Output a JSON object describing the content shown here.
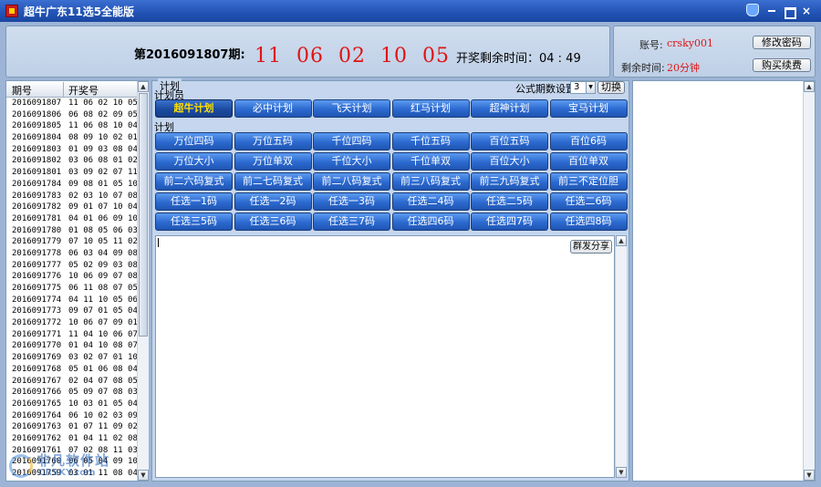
{
  "window": {
    "title": "超牛广东11选5全能版",
    "controls": {
      "minimize_icon": "minimize-icon",
      "restore_icon": "restore-icon",
      "close_label": "×"
    }
  },
  "draw": {
    "issue_label": "第2016091807期:",
    "numbers": [
      "11",
      "06",
      "02",
      "10",
      "05"
    ],
    "countdown": "开奖剩余时间：04 : 49"
  },
  "account": {
    "user_label": "账号:",
    "user_value": "crsky001",
    "remain_label": "剩余时间:",
    "remain_value": "20分钟",
    "change_pwd": "修改密码",
    "renew": "购买续费"
  },
  "history": {
    "col_issue": "期号",
    "col_numbers": "开奖号",
    "rows": [
      [
        "2016091807",
        "11 06 02 10 05"
      ],
      [
        "2016091806",
        "06 08 02 09 05"
      ],
      [
        "2016091805",
        "11 06 08 10 04"
      ],
      [
        "2016091804",
        "08 09 10 02 01"
      ],
      [
        "2016091803",
        "01 09 03 08 04"
      ],
      [
        "2016091802",
        "03 06 08 01 02"
      ],
      [
        "2016091801",
        "03 09 02 07 11"
      ],
      [
        "2016091784",
        "09 08 01 05 10"
      ],
      [
        "2016091783",
        "02 03 10 07 08"
      ],
      [
        "2016091782",
        "09 01 07 10 04"
      ],
      [
        "2016091781",
        "04 01 06 09 10"
      ],
      [
        "2016091780",
        "01 08 05 06 03"
      ],
      [
        "2016091779",
        "07 10 05 11 02"
      ],
      [
        "2016091778",
        "06 03 04 09 08"
      ],
      [
        "2016091777",
        "05 02 09 03 08"
      ],
      [
        "2016091776",
        "10 06 09 07 08"
      ],
      [
        "2016091775",
        "06 11 08 07 05"
      ],
      [
        "2016091774",
        "04 11 10 05 06"
      ],
      [
        "2016091773",
        "09 07 01 05 04"
      ],
      [
        "2016091772",
        "10 06 07 09 01"
      ],
      [
        "2016091771",
        "11 04 10 06 07"
      ],
      [
        "2016091770",
        "01 04 10 08 07"
      ],
      [
        "2016091769",
        "03 02 07 01 10"
      ],
      [
        "2016091768",
        "05 01 06 08 04"
      ],
      [
        "2016091767",
        "02 04 07 08 05"
      ],
      [
        "2016091766",
        "05 09 07 08 03"
      ],
      [
        "2016091765",
        "10 03 01 05 04"
      ],
      [
        "2016091764",
        "06 10 02 03 09"
      ],
      [
        "2016091763",
        "01 07 11 09 02"
      ],
      [
        "2016091762",
        "01 04 11 02 08"
      ],
      [
        "2016091761",
        "07 02 08 11 03"
      ],
      [
        "2016091760",
        "06 05 04 09 10"
      ],
      [
        "2016091759",
        "03 01 11 08 04"
      ]
    ]
  },
  "plan": {
    "legend": "计划",
    "planner_label": "计划员",
    "plan_label": "计划",
    "setting_label": "公式期数设置:",
    "setting_value": "3",
    "switch_label": "切换",
    "planners": [
      "超牛计划",
      "必中计划",
      "飞天计划",
      "红马计划",
      "超神计划",
      "宝马计划"
    ],
    "plan_rows": [
      [
        "万位四码",
        "万位五码",
        "千位四码",
        "千位五码",
        "百位五码",
        "百位6码"
      ],
      [
        "万位大小",
        "万位单双",
        "千位大小",
        "千位单双",
        "百位大小",
        "百位单双"
      ],
      [
        "前二六码复式",
        "前二七码复式",
        "前二八码复式",
        "前三八码复式",
        "前三九码复式",
        "前三不定位胆"
      ],
      [
        "任选一1码",
        "任选一2码",
        "任选一3码",
        "任选二4码",
        "任选二5码",
        "任选二6码"
      ],
      [
        "任选三5码",
        "任选三6码",
        "任选三7码",
        "任选四6码",
        "任选四7码",
        "任选四8码"
      ]
    ],
    "share_label": "群发分享"
  },
  "watermark": {
    "cn": "非凡软件站",
    "en": "CRSKY.com"
  }
}
